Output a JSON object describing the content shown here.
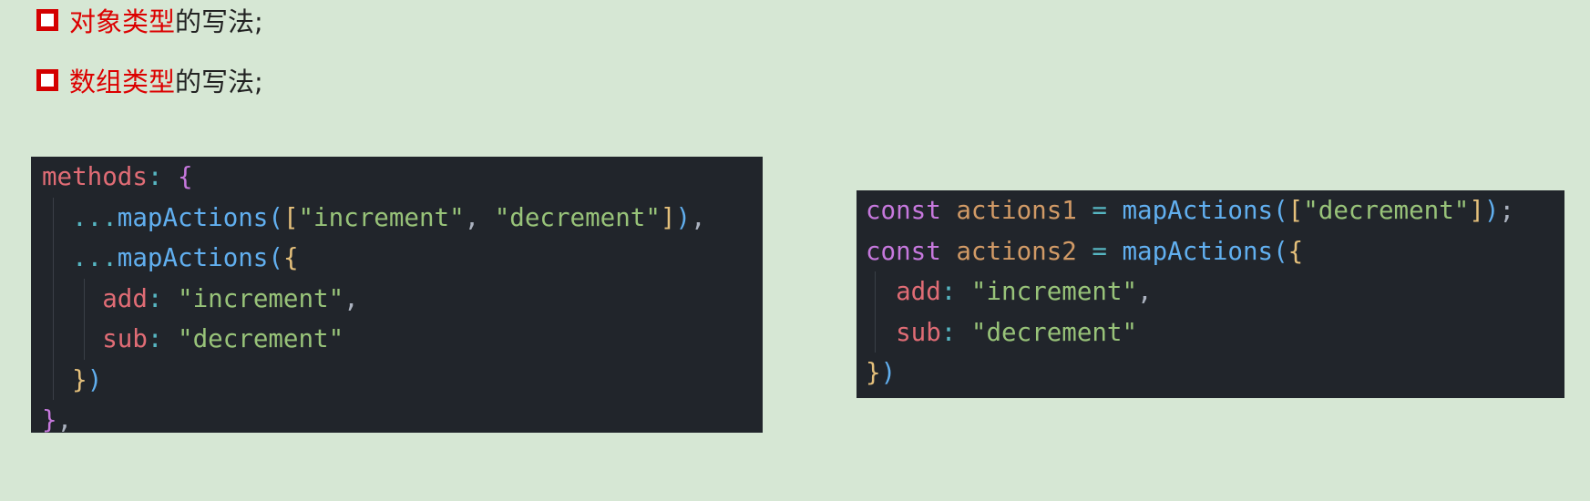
{
  "bullets": [
    {
      "highlight": "对象类型",
      "rest": "的写法;"
    },
    {
      "highlight": "数组类型",
      "rest": "的写法;"
    }
  ],
  "left_code": {
    "lines": [
      "methods: {",
      "  ...mapActions([\"increment\", \"decrement\"]),",
      "  ...mapActions({",
      "    add: \"increment\",",
      "    sub: \"decrement\"",
      "  })",
      "},"
    ]
  },
  "right_code": {
    "lines": [
      "const actions1 = mapActions([\"decrement\"]);",
      "const actions2 = mapActions({",
      "  add: \"increment\",",
      "  sub: \"decrement\"",
      "})"
    ]
  },
  "colors": {
    "background": "#d6e7d4",
    "highlight": "#dc0000",
    "code_bg": "#21252b"
  }
}
